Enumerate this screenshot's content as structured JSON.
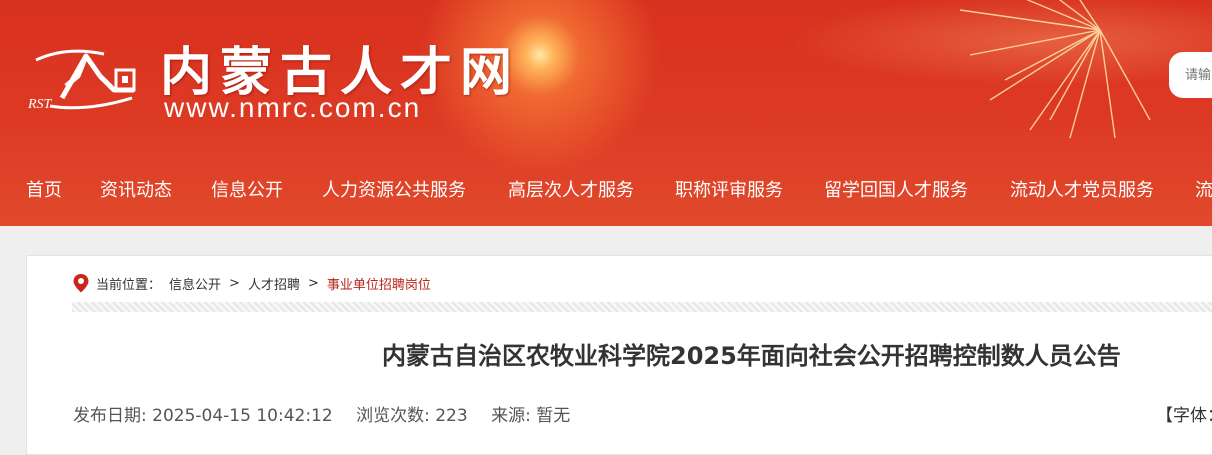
{
  "header": {
    "site_title": "内蒙古人才网",
    "site_url": "www.nmrc.com.cn",
    "logo_text": "RST",
    "search_placeholder": "请输"
  },
  "nav": {
    "items": [
      {
        "label": "首页"
      },
      {
        "label": "资讯动态"
      },
      {
        "label": "信息公开"
      },
      {
        "label": "人力资源公共服务"
      },
      {
        "label": "高层次人才服务"
      },
      {
        "label": "职称评审服务"
      },
      {
        "label": "留学回国人才服务"
      },
      {
        "label": "流动人才党员服务"
      },
      {
        "label": "流"
      }
    ]
  },
  "breadcrumb": {
    "prefix": "当前位置：",
    "items": [
      "信息公开",
      "人才招聘",
      "事业单位招聘岗位"
    ],
    "separator": ">"
  },
  "article": {
    "title": "内蒙古自治区农牧业科学院2025年面向社会公开招聘控制数人员公告",
    "publish_date": "发布日期: 2025-04-15 10:42:12",
    "views": "浏览次数: 223",
    "source": "来源: 暂无",
    "font_size_label": "【字体："
  },
  "colors": {
    "header_red": "#d8311f",
    "breadcrumb_current": "#b7241a"
  }
}
